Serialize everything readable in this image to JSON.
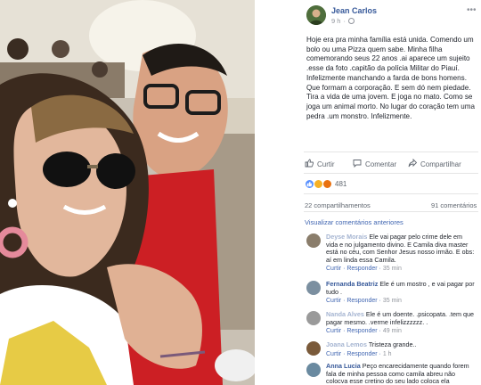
{
  "post": {
    "author": "Jean Carlos",
    "time": "9 h",
    "body": "Hoje era pra minha família está unida. Comendo um bolo ou uma Pizza quem sabe. Minha filha comemorando seus 22 anos .ai aparece um sujeito .esse da foto .capitão da polícia Militar do Piauí. Infelizmente manchando a farda de bons homens. Que formam a corporação. E sem dó nem piedade. Tira a vida de uma jovem. E joga no mato. Como se joga um animal morto. No lugar do coração tem uma pedra .um monstro. Infelizmente.",
    "more_label": "•••"
  },
  "actions": {
    "like": "Curtir",
    "comment": "Comentar",
    "share": "Compartilhar"
  },
  "stats": {
    "reactions_count": "481",
    "shares": "22 compartilhamentos",
    "comments": "91 comentários"
  },
  "view_previous": "Visualizar comentários anteriores",
  "comments": [
    {
      "name": "Deyse Morais",
      "text": "Ele vai pagar pelo crime dele em vida e no julgamento divino. E Camila diva master está no céu, com Senhor Jesus nosso irmão. E obs: aí em linda essa Camila.",
      "like": "Curtir",
      "reply": "Responder",
      "time": "35 min",
      "avatar_color": "#8a7d6b"
    },
    {
      "name": "Fernanda Beatriz",
      "text": "Ele é um mostro , e vai pagar por tudo .",
      "like": "Curtir",
      "reply": "Responder",
      "time": "35 min",
      "avatar_color": "#7b8fa0"
    },
    {
      "name": "Nanda Alves",
      "text": "Ele é um doente. .psicopata. .tem que pagar mesmo. .verme infelizzzzzz. .",
      "like": "Curtir",
      "reply": "Responder",
      "time": "49 min",
      "avatar_color": "#9a9a9a"
    },
    {
      "name": "Joana Lemos",
      "text": "Tristeza grande..",
      "like": "Curtir",
      "reply": "Responder",
      "time": "1 h",
      "avatar_color": "#7a5a3a"
    },
    {
      "name": "Anna Lucia",
      "text": "Peço encarecidamente quando forem fala de minha pessoa como camila abreu não colocva esse cretino do seu lado coloca ela",
      "like": "",
      "reply": "",
      "time": "",
      "avatar_color": "#6a8aa0"
    }
  ],
  "colors": {
    "link": "#365899",
    "background": "#000000",
    "panel": "#ffffff"
  },
  "icons": {
    "like": "thumbs-up-icon",
    "comment": "speech-bubble-icon",
    "share": "share-arrow-icon",
    "privacy": "globe-icon"
  }
}
